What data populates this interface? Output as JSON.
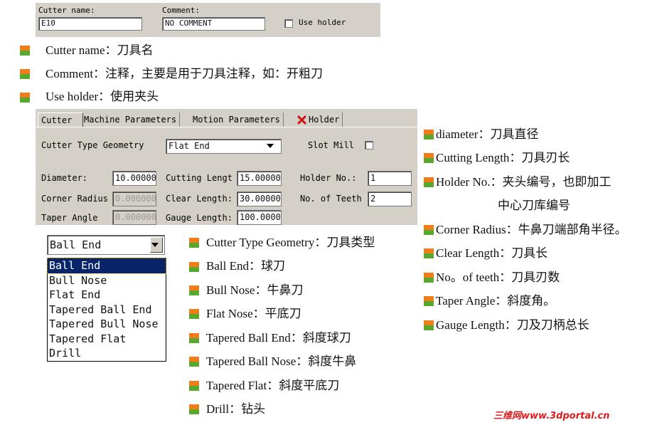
{
  "top_panel": {
    "cutter_name_label": "Cutter name:",
    "cutter_name_value": "E10",
    "comment_label": "Comment:",
    "comment_value": "NO COMMENT",
    "use_holder_label": "Use holder"
  },
  "top_bullets": [
    "Cutter name：刀具名",
    "Comment：注释，主要是用于刀具注释，如：开粗刀",
    "Use holder：使用夹头"
  ],
  "tabs": [
    {
      "label": "Cutter"
    },
    {
      "label": "Machine Parameters"
    },
    {
      "label": "Motion Parameters"
    },
    {
      "label": "Holder"
    }
  ],
  "dialog": {
    "geom_label": "Cutter Type Geometry",
    "geom_value": "Flat End",
    "slot_mill_label": "Slot Mill",
    "diameter_label": "Diameter:",
    "diameter_value": "10.00000",
    "corner_radius_label": "Corner Radius",
    "corner_radius_value": "0.000000",
    "taper_angle_label": "Taper Angle",
    "taper_angle_value": "0.000000",
    "cutting_length_label": "Cutting Lengt",
    "cutting_length_value": "15.00000",
    "clear_length_label": "Clear Length:",
    "clear_length_value": "30.00000",
    "gauge_length_label": "Gauge Length:",
    "gauge_length_value": "100.0000",
    "holder_no_label": "Holder No.:",
    "holder_no_value": "1",
    "teeth_label": "No. of Teeth",
    "teeth_value": "2"
  },
  "dropdown": {
    "selected": "Ball End",
    "options": [
      "Ball End",
      "Bull Nose",
      "Flat End",
      "Tapered Ball End",
      "Tapered Bull Nose",
      "Tapered Flat",
      "Drill"
    ]
  },
  "middle_bullets": [
    "Cutter Type Geometry：刀具类型",
    "Ball End：球刀",
    "Bull Nose：牛鼻刀",
    "Flat Nose：平底刀",
    "Tapered Ball End：斜度球刀",
    "Tapered Ball Nose：斜度牛鼻",
    "Tapered Flat：斜度平底刀",
    "Drill：钻头"
  ],
  "right_bullets": [
    "diameter：刀具直径",
    "Cutting Length：刀具刃长",
    "Holder No.：夹头编号，也即加工",
    "Corner Radius：牛鼻刀端部角半径。",
    "Clear Length：刀具长",
    "No。of teeth：刀具刃数",
    "Taper Angle：斜度角。",
    "Gauge Length：刀及刀柄总长"
  ],
  "holder_no_continuation": "中心刀库编号",
  "watermark": "三维网www.3dportal.cn",
  "icons": {
    "bullet": "square-bullet-icon",
    "holder_tab": "red-x-icon",
    "dropdown": "chevron-down-icon"
  }
}
